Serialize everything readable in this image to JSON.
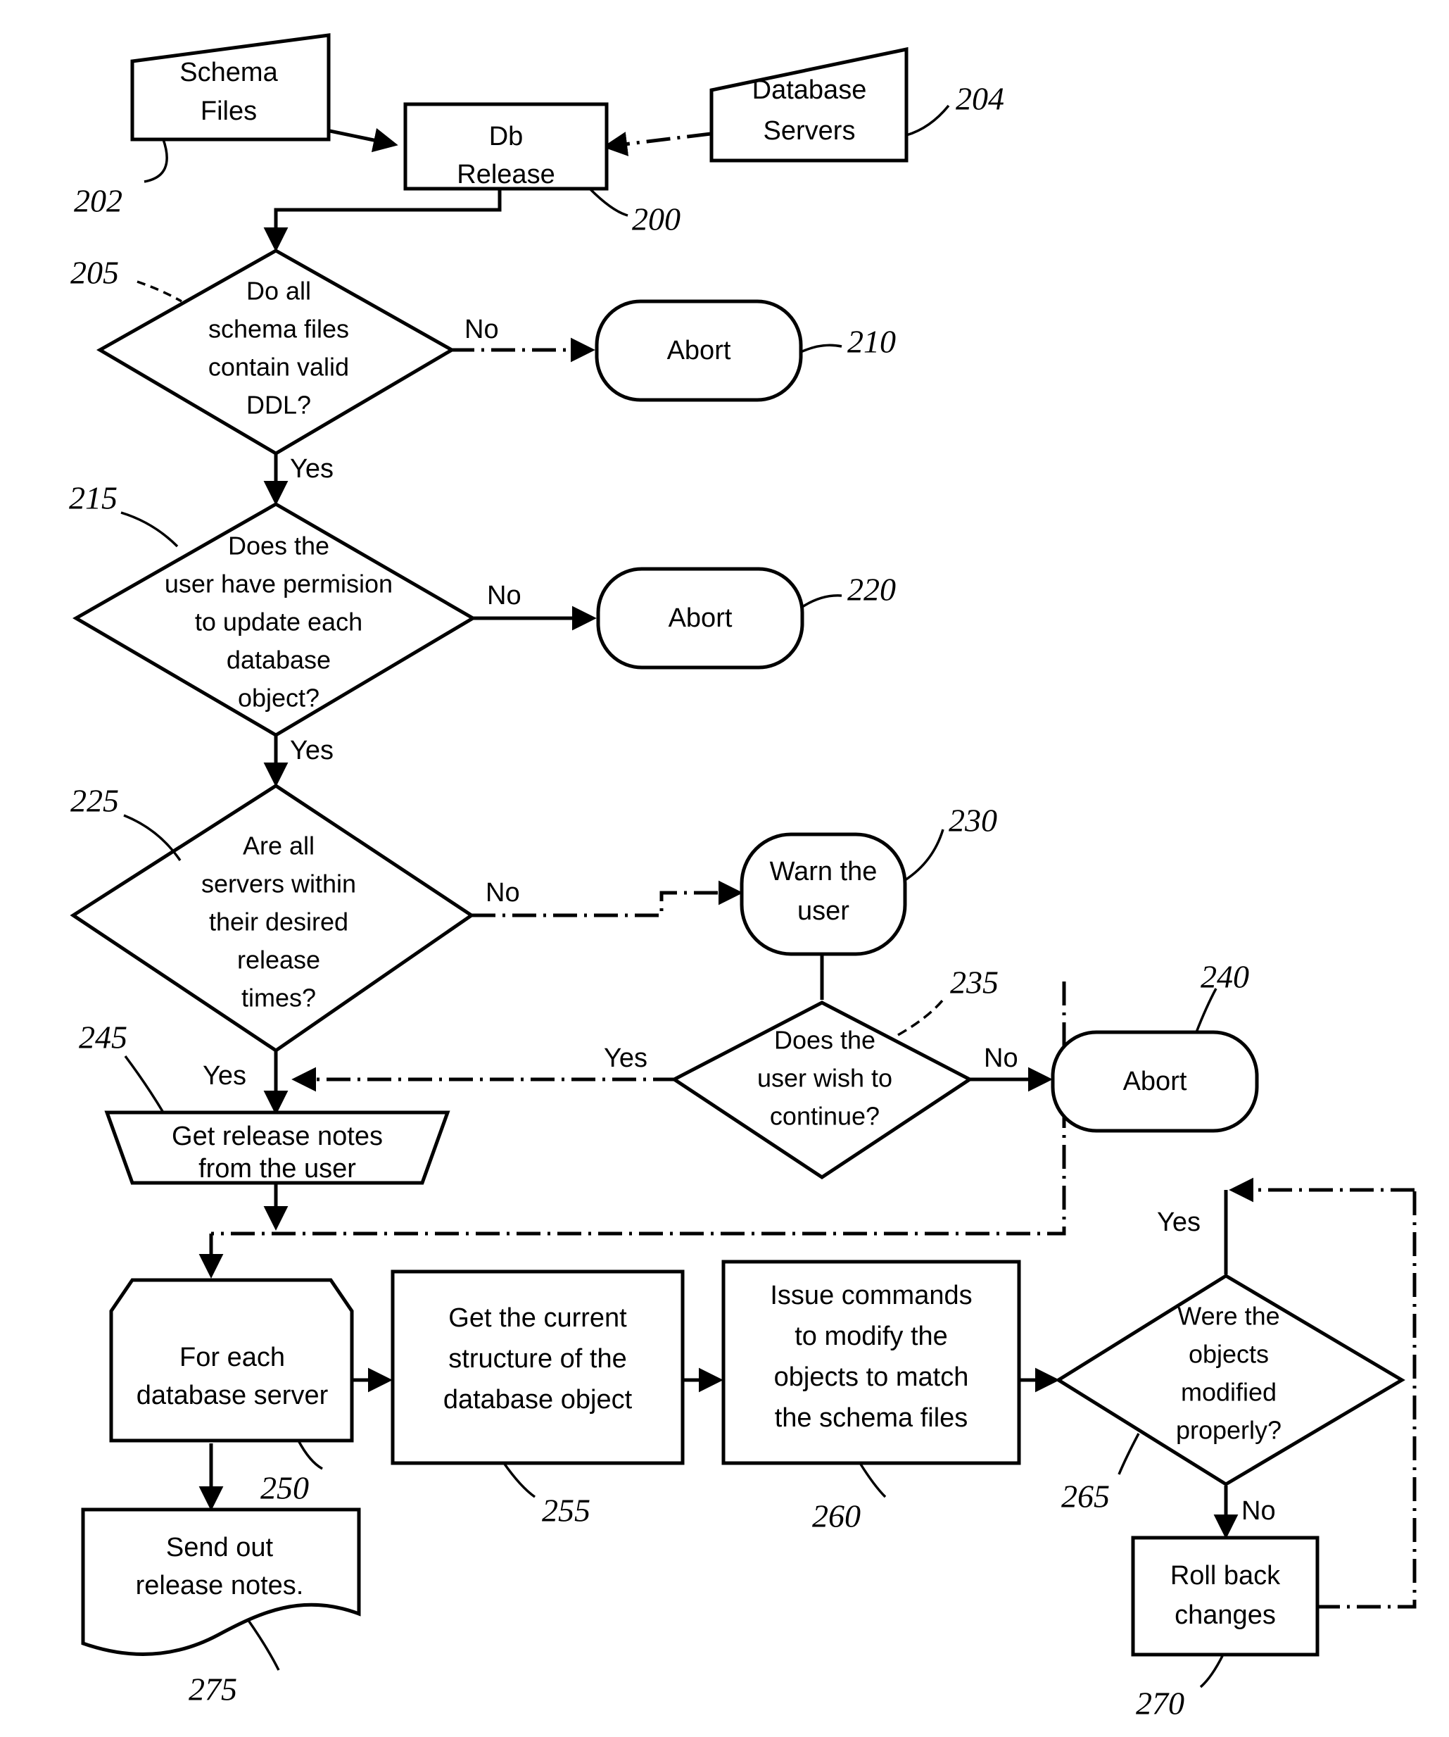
{
  "figure": {
    "type": "patent-flowchart",
    "title": "Database release process flowchart"
  },
  "nodes": {
    "schema_files": {
      "label_line1": "Schema",
      "label_line2": "Files",
      "ref": "202",
      "shape": "trapezoid-input"
    },
    "db_release": {
      "label_line1": "Db",
      "label_line2": "Release",
      "ref": "200",
      "shape": "rectangle"
    },
    "database_servers": {
      "label_line1": "Database",
      "label_line2": "Servers",
      "ref": "204",
      "shape": "trapezoid-input"
    },
    "decision_ddl": {
      "label_line1": "Do all",
      "label_line2": "schema files",
      "label_line3": "contain valid",
      "label_line4": "DDL?",
      "ref": "205",
      "shape": "diamond"
    },
    "abort_ddl": {
      "label": "Abort",
      "ref": "210",
      "shape": "rounded"
    },
    "decision_perm": {
      "label_line1": "Does the",
      "label_line2": "user have permision",
      "label_line3": "to update each",
      "label_line4": "database",
      "label_line5": "object?",
      "ref": "215",
      "shape": "diamond"
    },
    "abort_perm": {
      "label": "Abort",
      "ref": "220",
      "shape": "rounded"
    },
    "decision_times": {
      "label_line1": "Are all",
      "label_line2": "servers within",
      "label_line3": "their desired",
      "label_line4": "release",
      "label_line5": "times?",
      "ref": "225",
      "shape": "diamond"
    },
    "warn_user": {
      "label_line1": "Warn the",
      "label_line2": "user",
      "ref": "230",
      "shape": "rounded"
    },
    "decision_continue": {
      "label_line1": "Does the",
      "label_line2": "user wish to",
      "label_line3": "continue?",
      "ref": "235",
      "shape": "diamond"
    },
    "abort_continue": {
      "label": "Abort",
      "ref": "240",
      "shape": "rounded"
    },
    "get_notes": {
      "label_line1": "Get release notes",
      "label_line2": "from the user",
      "ref": "245",
      "shape": "trapezoid-output"
    },
    "for_each_server": {
      "label_line1": "For each",
      "label_line2": "database server",
      "ref": "250",
      "shape": "cut-corner-box"
    },
    "get_structure": {
      "label_line1": "Get the current",
      "label_line2": "structure of the",
      "label_line3": "database object",
      "ref": "255",
      "shape": "rectangle"
    },
    "issue_commands": {
      "label_line1": "Issue commands",
      "label_line2": "to modify the",
      "label_line3": "objects to match",
      "label_line4": "the schema files",
      "ref": "260",
      "shape": "rectangle"
    },
    "decision_modified": {
      "label_line1": "Were the",
      "label_line2": "objects",
      "label_line3": "modified",
      "label_line4": "properly?",
      "ref": "265",
      "shape": "diamond"
    },
    "roll_back": {
      "label_line1": "Roll back",
      "label_line2": "changes",
      "ref": "270",
      "shape": "rectangle"
    },
    "send_notes": {
      "label_line1": "Send out",
      "label_line2": "release notes.",
      "ref": "275",
      "shape": "document"
    }
  },
  "edge_labels": {
    "ddl_no": "No",
    "ddl_yes": "Yes",
    "perm_no": "No",
    "perm_yes": "Yes",
    "times_no": "No",
    "times_yes": "Yes",
    "continue_yes": "Yes",
    "continue_no": "No",
    "modified_yes": "Yes",
    "modified_no": "No"
  },
  "colors": {
    "ink": "#000000",
    "paper": "#ffffff"
  }
}
